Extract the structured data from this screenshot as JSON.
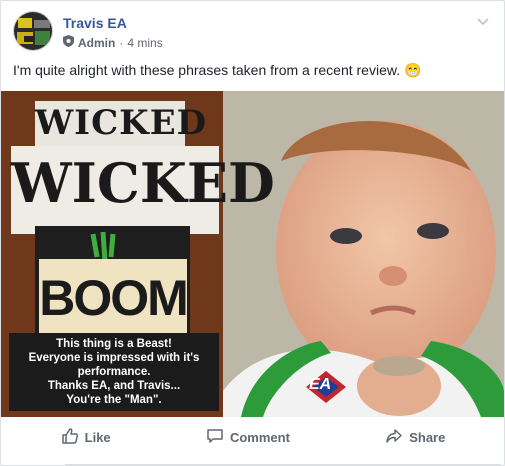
{
  "post": {
    "author": "Travis EA",
    "role": "Admin",
    "separator": "·",
    "time": "4 mins",
    "text": "I'm quite alright with these phrases taken from a recent review. 😁"
  },
  "image": {
    "sign_line1": "WICKED",
    "sign_line2": "WICKED",
    "boom": "BOOM",
    "caption_lines": [
      "This thing is a Beast!",
      "Everyone is impressed with it's",
      "performance.",
      "Thanks EA, and Travis...",
      "You're the \"Man\"."
    ],
    "shirt_logo": "EA"
  },
  "actions": {
    "like": "Like",
    "comment": "Comment",
    "share": "Share"
  },
  "colors": {
    "link": "#365899",
    "muted": "#606770",
    "shirt_green": "#2e9b3a"
  }
}
